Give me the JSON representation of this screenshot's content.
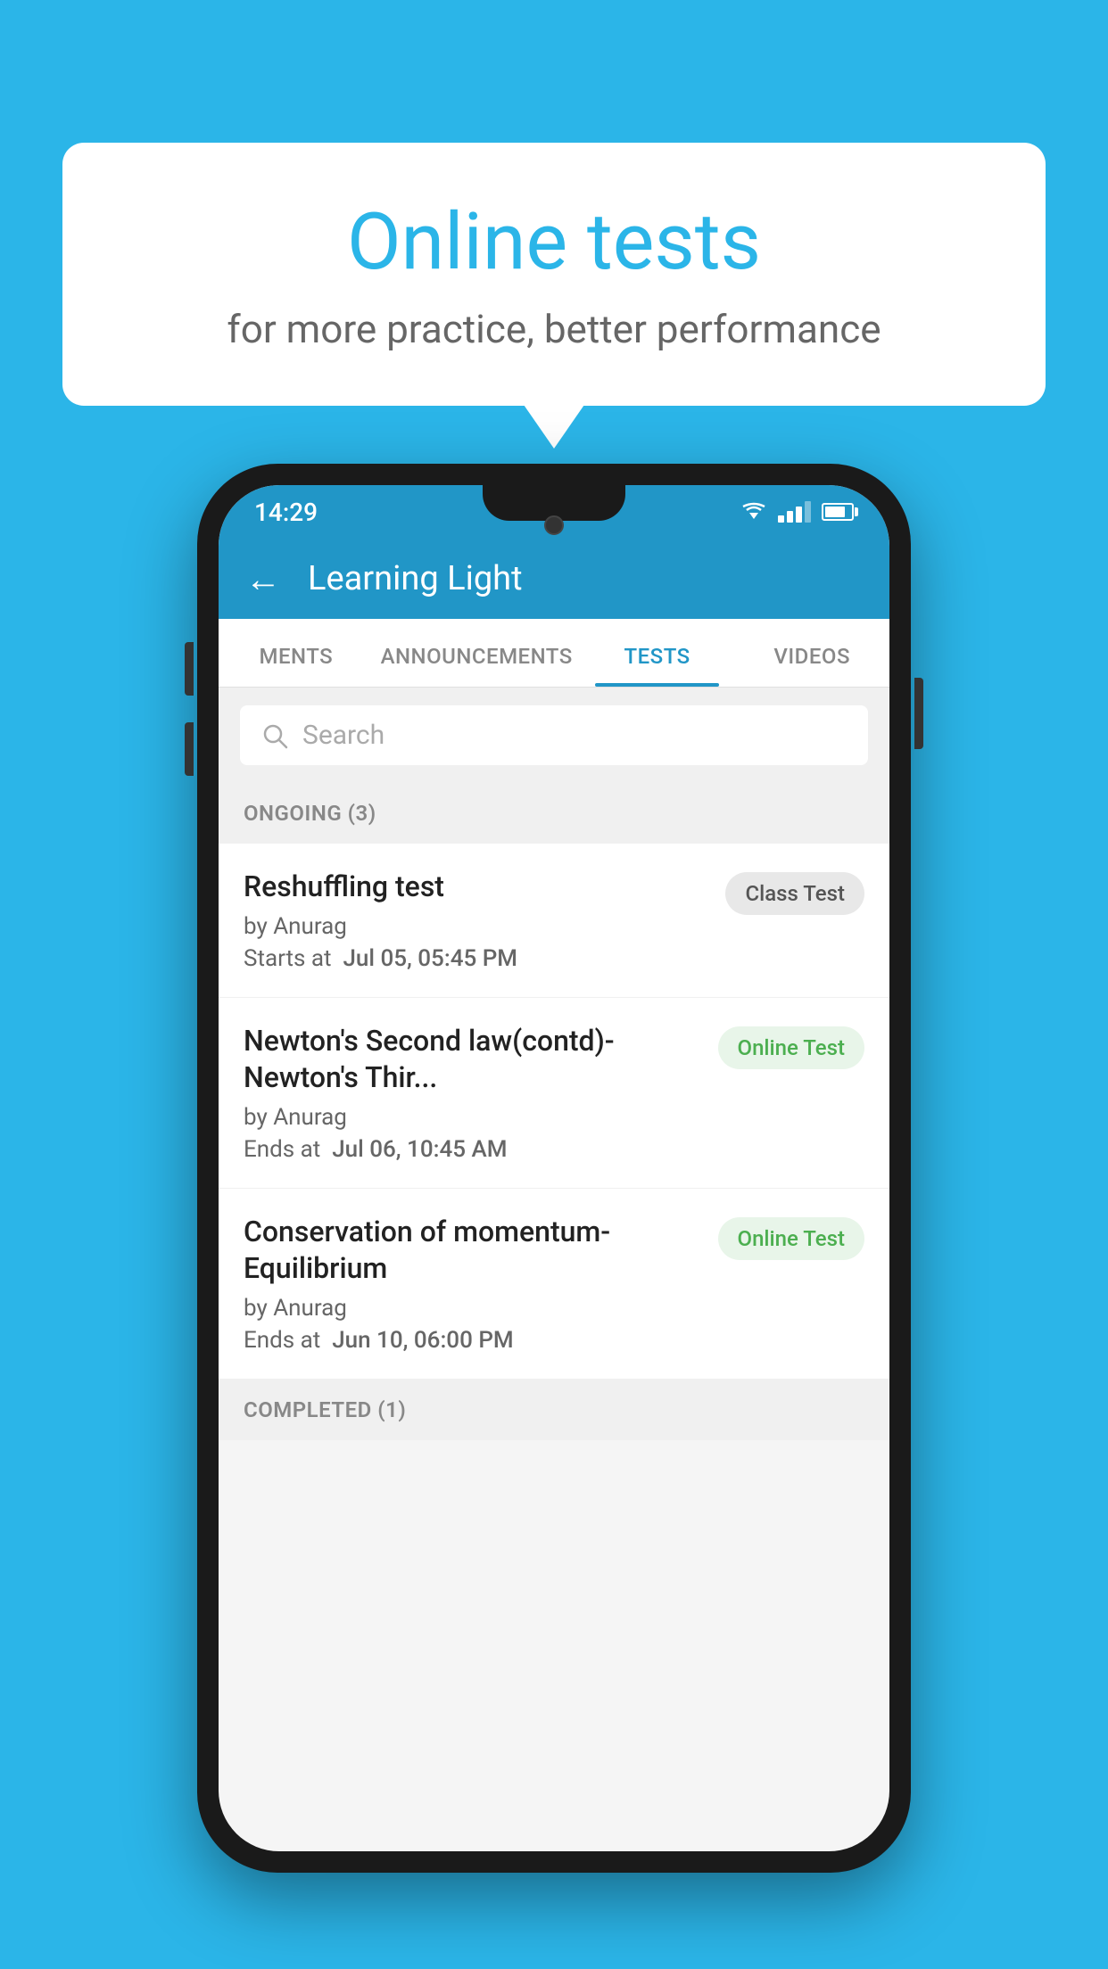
{
  "background": {
    "color": "#2bb5e8"
  },
  "speech_bubble": {
    "title": "Online tests",
    "subtitle": "for more practice, better performance"
  },
  "status_bar": {
    "time": "14:29",
    "wifi": "▼",
    "battery_level": "70"
  },
  "app_header": {
    "back_label": "←",
    "title": "Learning Light"
  },
  "tabs": [
    {
      "label": "MENTS",
      "active": false
    },
    {
      "label": "ANNOUNCEMENTS",
      "active": false
    },
    {
      "label": "TESTS",
      "active": true
    },
    {
      "label": "VIDEOS",
      "active": false
    }
  ],
  "search": {
    "placeholder": "Search"
  },
  "ongoing_section": {
    "title": "ONGOING (3)"
  },
  "tests": [
    {
      "name": "Reshuffling test",
      "by": "by Anurag",
      "date_label": "Starts at",
      "date": "Jul 05, 05:45 PM",
      "badge": "Class Test",
      "badge_type": "class"
    },
    {
      "name": "Newton's Second law(contd)-Newton's Thir...",
      "by": "by Anurag",
      "date_label": "Ends at",
      "date": "Jul 06, 10:45 AM",
      "badge": "Online Test",
      "badge_type": "online"
    },
    {
      "name": "Conservation of momentum-Equilibrium",
      "by": "by Anurag",
      "date_label": "Ends at",
      "date": "Jun 10, 06:00 PM",
      "badge": "Online Test",
      "badge_type": "online"
    }
  ],
  "completed_section": {
    "title": "COMPLETED (1)"
  }
}
